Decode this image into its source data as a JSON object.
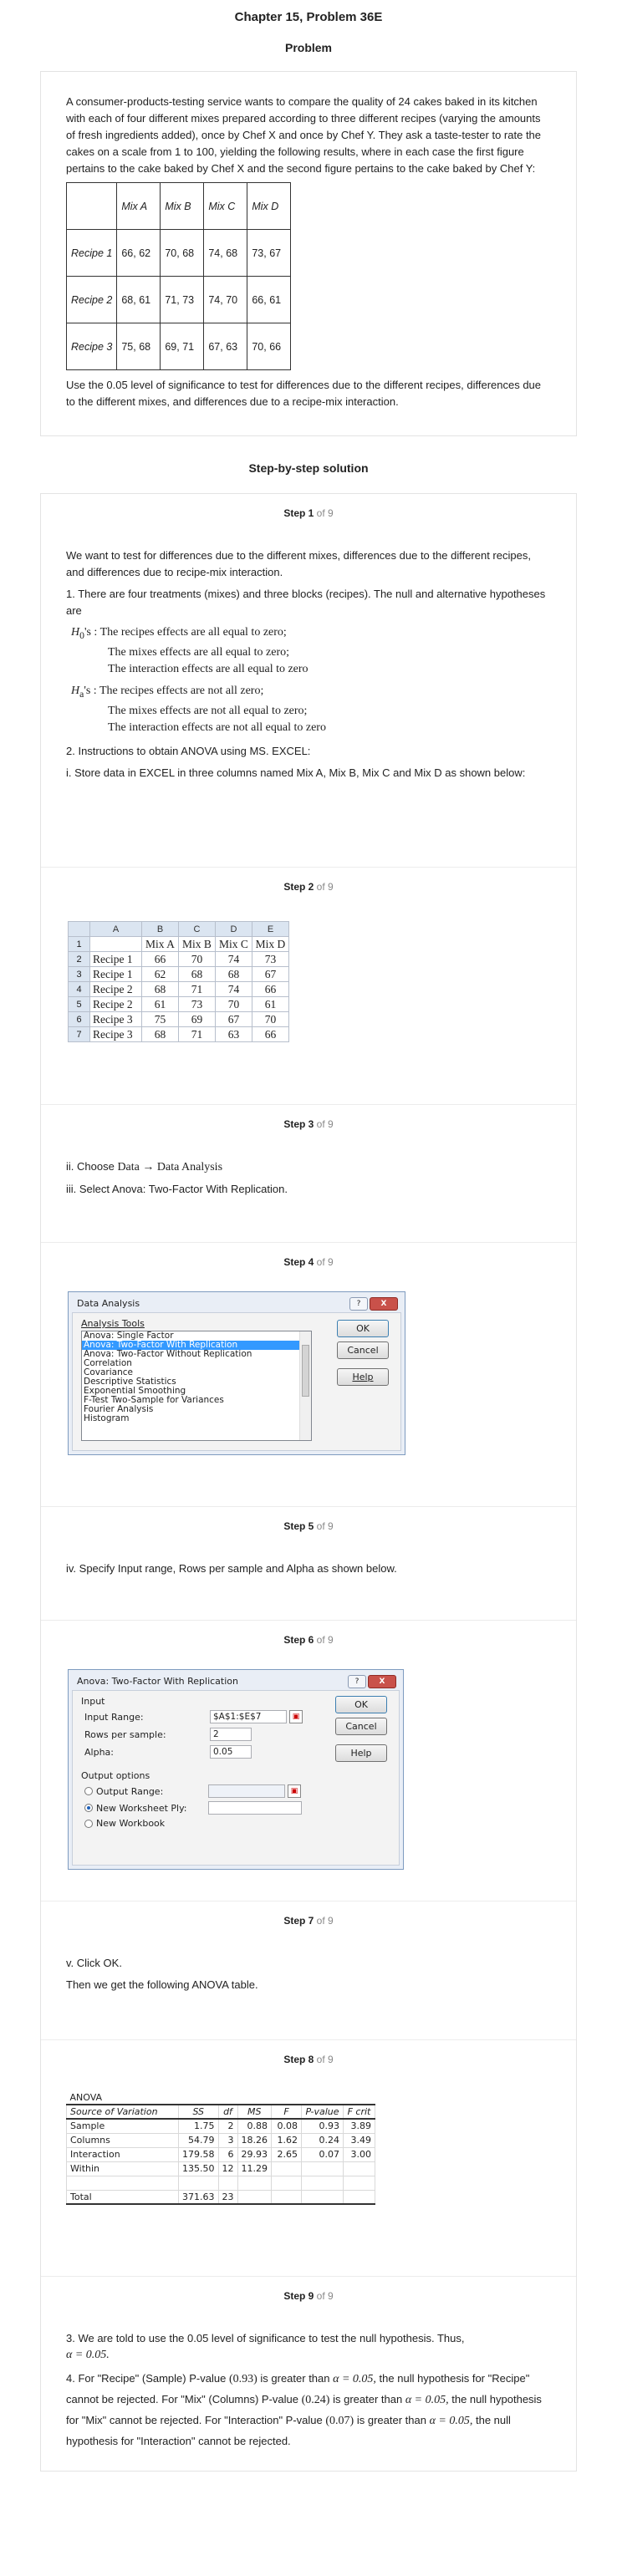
{
  "header": {
    "title": "Chapter 15, Problem 36E",
    "problem_heading": "Problem"
  },
  "problem": {
    "text": "A consumer-products-testing service wants to compare the quality of 24 cakes baked in its kitchen with each of four different mixes prepared according to three different recipes (varying the amounts of fresh ingredients added), once by Chef X and once by Chef Y. They ask a taste-tester to rate the cakes on a scale from 1 to 100, yielding the following results, where in each case the first figure pertains to the cake baked by Chef X and the second figure pertains to the cake baked by Chef Y:",
    "table": {
      "columns": [
        "",
        "Mix A",
        "Mix B",
        "Mix C",
        "Mix D"
      ],
      "rows": [
        [
          "Recipe 1",
          "66, 62",
          "70, 68",
          "74, 68",
          "73, 67"
        ],
        [
          "Recipe 2",
          "68, 61",
          "71, 73",
          "74, 70",
          "66, 61"
        ],
        [
          "Recipe 3",
          "75, 68",
          "69, 71",
          "67, 63",
          "70, 66"
        ]
      ]
    },
    "footer": "Use the 0.05 level of significance to test for differences due to the different recipes, differences due to the different mixes, and differences due to a recipe-mix interaction."
  },
  "solution_heading": "Step-by-step solution",
  "steps": [
    {
      "label": "Step 1",
      "of": "of 9"
    },
    {
      "label": "Step 2",
      "of": "of 9"
    },
    {
      "label": "Step 3",
      "of": "of 9"
    },
    {
      "label": "Step 4",
      "of": "of 9"
    },
    {
      "label": "Step 5",
      "of": "of 9"
    },
    {
      "label": "Step 6",
      "of": "of 9"
    },
    {
      "label": "Step 7",
      "of": "of 9"
    },
    {
      "label": "Step 8",
      "of": "of 9"
    },
    {
      "label": "Step 9",
      "of": "of 9"
    }
  ],
  "step1": {
    "intro": "We want to test for differences due to the different mixes, differences due to the different recipes, and differences due to recipe-mix interaction.",
    "p1": "1. There are four treatments (mixes) and three blocks (recipes). The null and alternative hypotheses are",
    "h0_label": "H",
    "h0_sub": "0",
    "h0_suffix": "'s :",
    "h0_lines": [
      "The recipes effects are all equal to zero;",
      "The mixes effects are all equal to zero;",
      "The interaction effects are all equal to zero"
    ],
    "ha_label": "H",
    "ha_sub": "a",
    "ha_suffix": "'s :",
    "ha_lines": [
      "The recipes effects are not all zero;",
      "The mixes effects are not all equal to zero;",
      "The interaction effects are not all equal to zero"
    ],
    "p2": "2. Instructions to obtain ANOVA using MS. EXCEL:",
    "p3": "i. Store data in EXCEL in three columns named Mix A, Mix B, Mix C and Mix D as shown below:"
  },
  "step2": {
    "col_headers": [
      "A",
      "B",
      "C",
      "D",
      "E"
    ],
    "row_numbers": [
      "1",
      "2",
      "3",
      "4",
      "5",
      "6",
      "7"
    ],
    "rows": [
      [
        "",
        "Mix A",
        "Mix B",
        "Mix C",
        "Mix D"
      ],
      [
        "Recipe 1",
        "66",
        "70",
        "74",
        "73"
      ],
      [
        "Recipe 1",
        "62",
        "68",
        "68",
        "67"
      ],
      [
        "Recipe 2",
        "68",
        "71",
        "74",
        "66"
      ],
      [
        "Recipe 2",
        "61",
        "73",
        "70",
        "61"
      ],
      [
        "Recipe 3",
        "75",
        "69",
        "67",
        "70"
      ],
      [
        "Recipe 3",
        "68",
        "71",
        "63",
        "66"
      ]
    ]
  },
  "step3": {
    "line1_prefix": "ii. Choose",
    "line1_menu": "Data → Data Analysis",
    "line2": "iii. Select Anova: Two-Factor With Replication."
  },
  "step4": {
    "dialog_title": "Data Analysis",
    "help_btn": "?",
    "close_btn": "X",
    "group_label": "Analysis Tools",
    "tools": [
      "Anova: Single Factor",
      "Anova: Two-Factor With Replication",
      "Anova: Two-Factor Without Replication",
      "Correlation",
      "Covariance",
      "Descriptive Statistics",
      "Exponential Smoothing",
      "F-Test Two-Sample for Variances",
      "Fourier Analysis",
      "Histogram"
    ],
    "ok": "OK",
    "cancel": "Cancel",
    "help": "Help"
  },
  "step5": {
    "text": "iv. Specify Input range, Rows per sample and Alpha as shown below."
  },
  "step6": {
    "dialog_title": "Anova: Two-Factor With Replication",
    "help_btn": "?",
    "close_btn": "X",
    "input_group": "Input",
    "input_range_label": "Input Range:",
    "input_range_value": "$A$1:$E$7",
    "rows_label": "Rows per sample:",
    "rows_value": "2",
    "alpha_label": "Alpha:",
    "alpha_value": "0.05",
    "output_group": "Output options",
    "output_range": "Output Range:",
    "new_sheet": "New Worksheet Ply:",
    "new_book": "New Workbook",
    "ok": "OK",
    "cancel": "Cancel",
    "help": "Help"
  },
  "step7": {
    "line1": "v. Click OK.",
    "line2": "Then we get the following ANOVA table."
  },
  "step8": {
    "title": "ANOVA",
    "headers": [
      "Source of Variation",
      "SS",
      "df",
      "MS",
      "F",
      "P-value",
      "F crit"
    ],
    "rows": [
      [
        "Sample",
        "1.75",
        "2",
        "0.88",
        "0.08",
        "0.93",
        "3.89"
      ],
      [
        "Columns",
        "54.79",
        "3",
        "18.26",
        "1.62",
        "0.24",
        "3.49"
      ],
      [
        "Interaction",
        "179.58",
        "6",
        "29.93",
        "2.65",
        "0.07",
        "3.00"
      ],
      [
        "Within",
        "135.50",
        "12",
        "11.29",
        "",
        "",
        ""
      ],
      [
        "",
        "",
        "",
        "",
        "",
        "",
        ""
      ],
      [
        "Total",
        "371.63",
        "23",
        "",
        "",
        "",
        ""
      ]
    ]
  },
  "step9": {
    "p1": "3. We are told to use the 0.05 level of significance to test the null hypothesis. Thus,",
    "alpha_eq": "α = 0.05.",
    "p2a": "4. For \"Recipe\" (Sample) P-value",
    "v1": "(0.93)",
    "p2b": "is greater than",
    "a1": "α = 0.05,",
    "p2c": "the null hypothesis for \"Recipe\" cannot be rejected. For \"Mix\" (Columns) P-value",
    "v2": "(0.24)",
    "p2d": "is greater than",
    "a2": "α = 0.05,",
    "p2e": "the null hypothesis for \"Mix\" cannot be rejected. For \"Interaction\" P-value",
    "v3": "(0.07)",
    "p2f": "is greater than",
    "a3": "α = 0.05,",
    "p2g": "the null hypothesis for \"Interaction\" cannot be rejected."
  }
}
